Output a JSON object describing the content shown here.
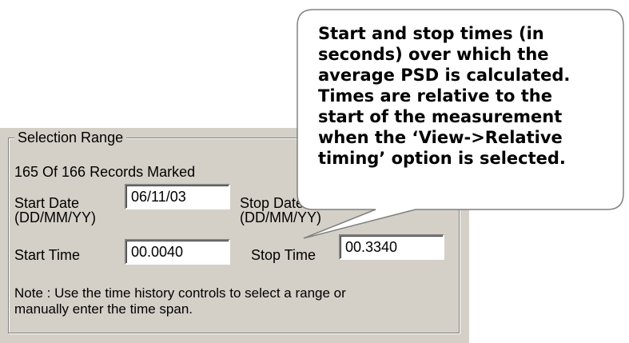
{
  "group": {
    "title": "Selection Range",
    "records_marked": "165 Of 166 Records Marked",
    "start_date_label_1": "Start Date",
    "start_date_label_2": "(DD/MM/YY)",
    "start_date_value": "06/11/03",
    "stop_date_label_1": "Stop Date",
    "stop_date_label_2": "(DD/MM/YY)",
    "start_time_label": "Start Time",
    "start_time_value": "00.0040",
    "stop_time_label": "Stop Time",
    "stop_time_value": "00.3340",
    "note_line_1": "Note : Use the time history controls to select a range or",
    "note_line_2": "manually enter the time span."
  },
  "callout": {
    "text_1": "Start and stop times (in",
    "text_2": "seconds) over which the",
    "text_3": "average PSD is calculated.",
    "text_4": "Times are relative to the",
    "text_5": "start of the measurement",
    "text_6": "when the ‘View->Relative",
    "text_7": "timing’ option is selected."
  }
}
